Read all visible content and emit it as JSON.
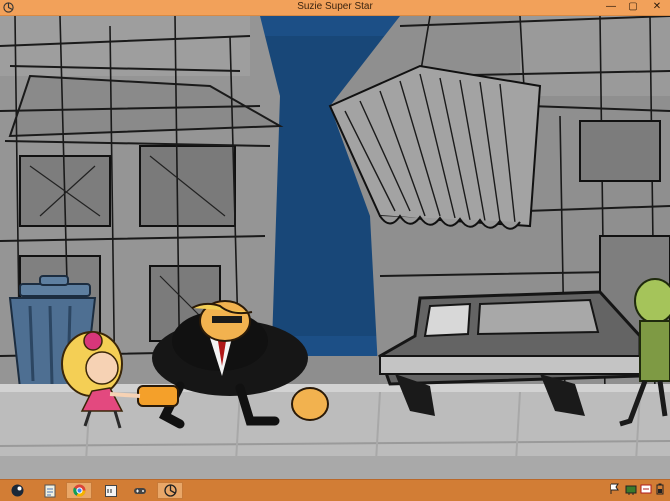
{
  "window": {
    "title": "Suzie Super Star",
    "controls": {
      "minimize": "—",
      "maximize": "▢",
      "close": "✕"
    },
    "accent_color": "#f2a15a"
  },
  "scene": {
    "characters": [
      "girl-character",
      "bodyguard-character",
      "zombie-character"
    ],
    "props": [
      "trash-can",
      "hearse-car",
      "awning",
      "buildings"
    ],
    "colors": {
      "sky": "#1c4f86",
      "sidewalk": "#bdbdbd",
      "buildings": "#8d8d8d"
    }
  },
  "taskbar": {
    "items": [
      {
        "icon": "steam-icon"
      },
      {
        "icon": "notepad-icon"
      },
      {
        "icon": "chrome-icon"
      },
      {
        "icon": "terminal-icon"
      },
      {
        "icon": "game-controller-icon"
      },
      {
        "icon": "unity-icon"
      }
    ],
    "tray_icons": [
      "flag-icon",
      "network-icon",
      "volume-icon",
      "battery-icon"
    ]
  }
}
